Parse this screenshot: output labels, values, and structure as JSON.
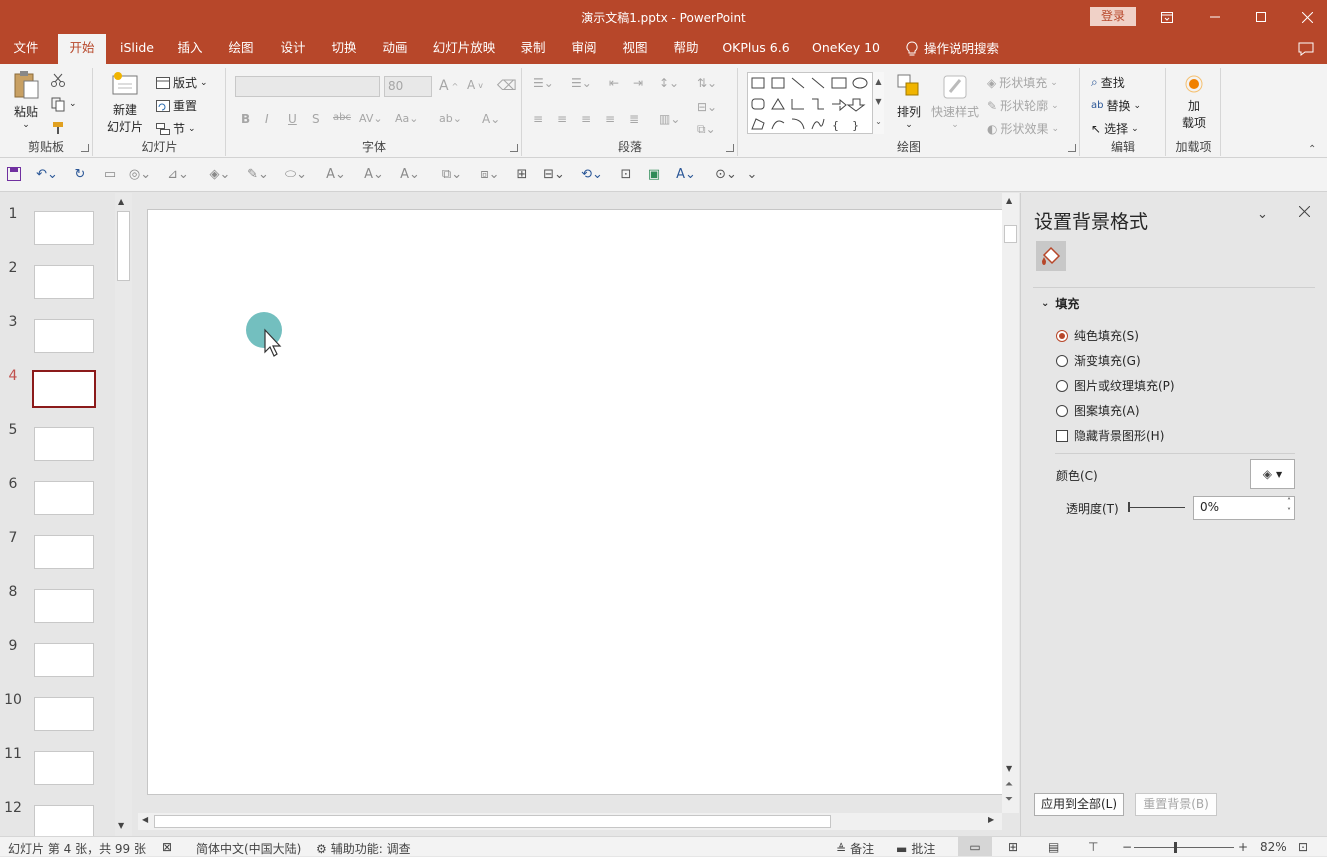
{
  "window": {
    "title": "演示文稿1.pptx  -  PowerPoint",
    "login_label": "登录",
    "icons": [
      "ribbon-display-icon",
      "minimize-icon",
      "maximize-icon",
      "close-icon"
    ]
  },
  "tabs": [
    {
      "label": "文件"
    },
    {
      "label": "开始"
    },
    {
      "label": "iSlide"
    },
    {
      "label": "插入"
    },
    {
      "label": "绘图"
    },
    {
      "label": "设计"
    },
    {
      "label": "切换"
    },
    {
      "label": "动画"
    },
    {
      "label": "幻灯片放映"
    },
    {
      "label": "录制"
    },
    {
      "label": "审阅"
    },
    {
      "label": "视图"
    },
    {
      "label": "帮助"
    },
    {
      "label": "OKPlus 6.6"
    },
    {
      "label": "OneKey 10"
    }
  ],
  "active_tab": "开始",
  "tell_me": "操作说明搜索",
  "ribbon": {
    "clipboard": {
      "label": "剪贴板",
      "paste": "粘贴"
    },
    "slides": {
      "label": "幻灯片",
      "new_slide_line1": "新建",
      "new_slide_line2": "幻灯片",
      "layout": "版式",
      "reset": "重置",
      "section": "节"
    },
    "font": {
      "label": "字体",
      "size": "80"
    },
    "paragraph": {
      "label": "段落"
    },
    "drawing": {
      "label": "绘图",
      "arrange": "排列",
      "quick_styles": "快速样式",
      "shape_fill": "形状填充",
      "shape_outline": "形状轮廓",
      "shape_effects": "形状效果"
    },
    "editing": {
      "label": "编辑",
      "find": "查找",
      "replace": "替换",
      "select": "选择"
    },
    "addins": {
      "label": "加载项",
      "addins_line1": "加",
      "addins_line2": "载项"
    }
  },
  "slides": {
    "numbers": [
      "1",
      "2",
      "3",
      "4",
      "5",
      "6",
      "7",
      "8",
      "9",
      "10",
      "11",
      "12"
    ],
    "selected": "4"
  },
  "pane": {
    "title": "设置背景格式",
    "section": "填充",
    "options": [
      {
        "label": "纯色填充(S)",
        "checked": true
      },
      {
        "label": "渐变填充(G)",
        "checked": false
      },
      {
        "label": "图片或纹理填充(P)",
        "checked": false
      },
      {
        "label": "图案填充(A)",
        "checked": false
      }
    ],
    "hide_bg": "隐藏背景图形(H)",
    "color_label": "颜色(C)",
    "transparency_label": "透明度(T)",
    "transparency_value": "0%",
    "apply_all": "应用到全部(L)",
    "reset_bg": "重置背景(B)"
  },
  "status": {
    "slide_info": "幻灯片 第 4 张，共 99 张",
    "language": "简体中文(中国大陆)",
    "accessibility": "辅助功能: 调查",
    "notes": "备注",
    "comments": "批注",
    "zoom": "82%"
  }
}
